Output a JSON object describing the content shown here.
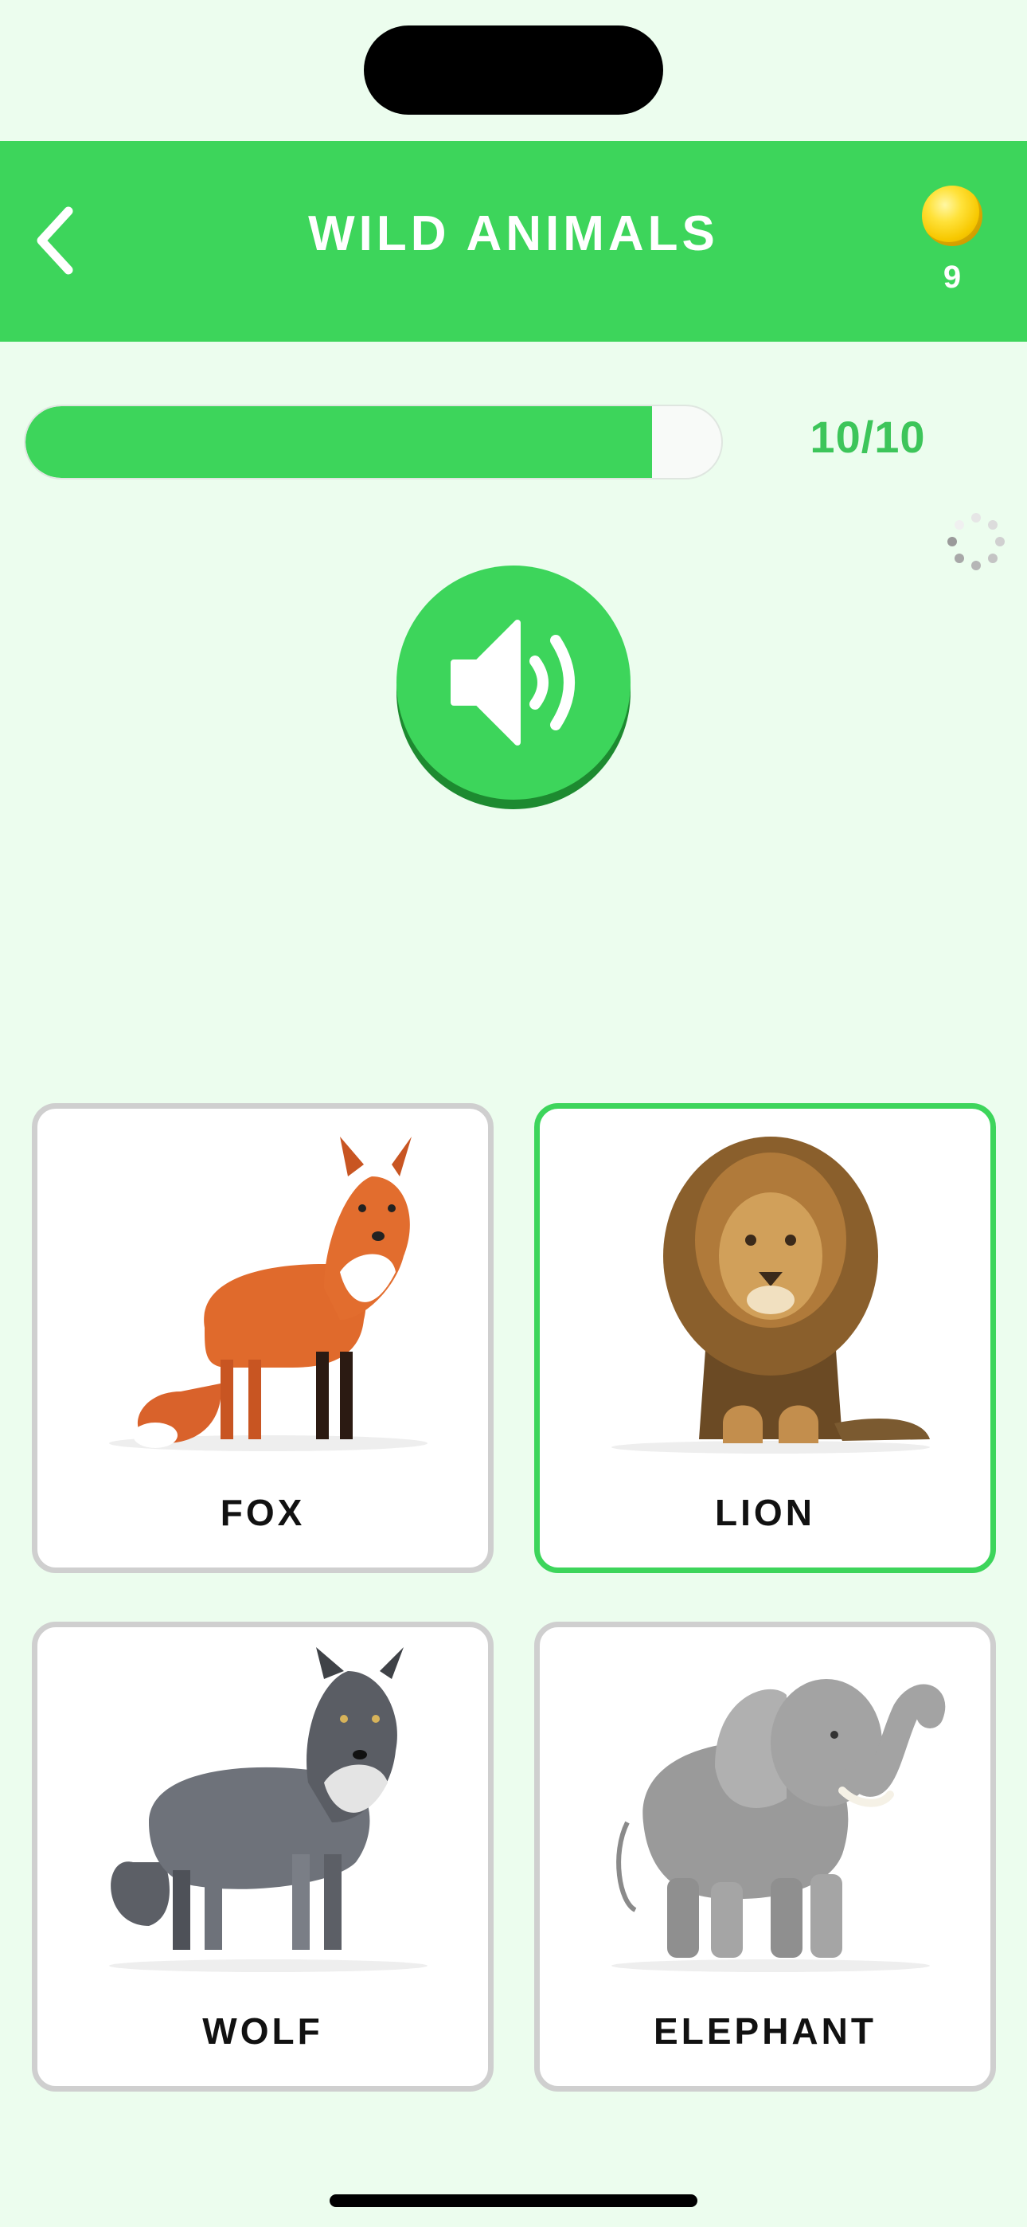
{
  "header": {
    "title": "WILD ANIMALS",
    "coins": "9"
  },
  "progress": {
    "current": 10,
    "total": 10,
    "text": "10/10",
    "fill_fraction": 0.9
  },
  "colors": {
    "brand_green": "#3dd55b",
    "background": "#ecfdee",
    "card_border": "#cfcfcf",
    "selected_border": "#3dd55b"
  },
  "icons": {
    "back": "chevron-left-icon",
    "coin": "coin-icon",
    "sound": "speaker-icon",
    "loading": "loading-spinner-icon"
  },
  "options": [
    {
      "label": "FOX",
      "selected": false
    },
    {
      "label": "LION",
      "selected": true
    },
    {
      "label": "WOLF",
      "selected": false
    },
    {
      "label": "ELEPHANT",
      "selected": false
    }
  ]
}
